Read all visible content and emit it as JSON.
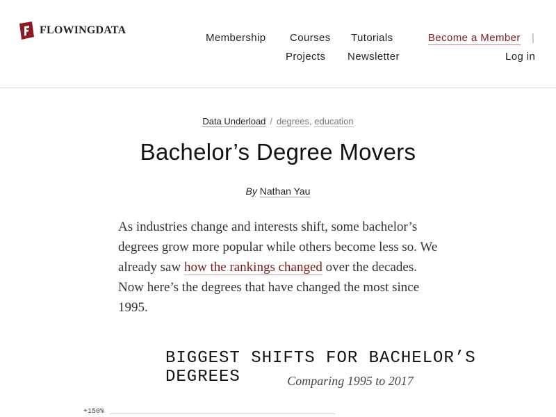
{
  "brand": {
    "name": "FLOWINGDATA",
    "accent": "#8a1c24"
  },
  "nav": {
    "membership": "Membership",
    "courses": "Courses",
    "tutorials": "Tutorials",
    "become_member": "Become a Member",
    "separator": "|",
    "projects": "Projects",
    "newsletter": "Newsletter",
    "login": "Log in"
  },
  "breadcrumb": {
    "category": "Data Underload",
    "slash": "/",
    "tags": [
      "degrees",
      "education"
    ]
  },
  "article": {
    "title": "Bachelor’s Degree Movers",
    "by_label": "By",
    "author": "Nathan Yau",
    "intro_before": "As industries change and interests shift, some bachelor’s degrees grow more popular while others become less so. We already saw ",
    "intro_link": "how the rankings changed",
    "intro_after": " over the decades. Now here’s the degrees that have changed the most since 1995."
  },
  "chart_data": {
    "type": "bar",
    "title": "BIGGEST SHIFTS FOR BACHELOR’S DEGREES",
    "subtitle": "Comparing 1995 to 2017",
    "y_ticks": [
      "+150%"
    ]
  }
}
